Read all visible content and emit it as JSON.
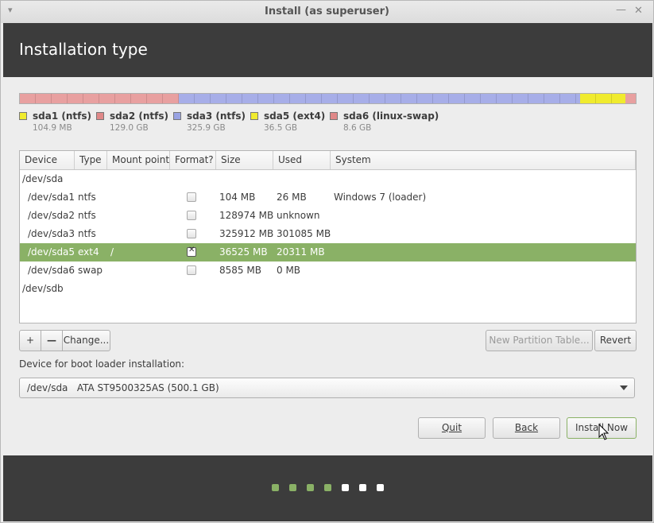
{
  "window": {
    "title": "Install (as superuser)",
    "menu_glyph": "▾",
    "minimize_glyph": "—",
    "close_glyph": "✕"
  },
  "header": {
    "title": "Installation type"
  },
  "partition_bar": {
    "segments": [
      {
        "id": "sda1",
        "color": "#f0eb2e",
        "share": 0.0002
      },
      {
        "id": "sda2",
        "color": "#e8a0a0",
        "share": 0.2579
      },
      {
        "id": "sda3",
        "color": "#a7aee8",
        "share": 0.6516
      },
      {
        "id": "sda5",
        "color": "#f0eb2e",
        "share": 0.073
      },
      {
        "id": "sda6",
        "color": "#e8a0a0",
        "share": 0.0173
      }
    ]
  },
  "legend": [
    {
      "name": "sda1 (ntfs)",
      "size": "104.9 MB",
      "color": "#f0eb2e"
    },
    {
      "name": "sda2 (ntfs)",
      "size": "129.0 GB",
      "color": "#e08888"
    },
    {
      "name": "sda3 (ntfs)",
      "size": "325.9 GB",
      "color": "#99a3e3"
    },
    {
      "name": "sda5 (ext4)",
      "size": "36.5 GB",
      "color": "#f0eb2e"
    },
    {
      "name": "sda6 (linux-swap)",
      "size": "8.6 GB",
      "color": "#e08888"
    }
  ],
  "table": {
    "headers": [
      "Device",
      "Type",
      "Mount point",
      "Format?",
      "Size",
      "Used",
      "System"
    ],
    "rows": [
      {
        "device": "/dev/sda",
        "type": "",
        "mount": "",
        "format": null,
        "size": "",
        "used": "",
        "system": "",
        "disk": true
      },
      {
        "device": "/dev/sda1",
        "type": "ntfs",
        "mount": "",
        "format": false,
        "size": "104 MB",
        "used": "26 MB",
        "system": "Windows 7 (loader)"
      },
      {
        "device": "/dev/sda2",
        "type": "ntfs",
        "mount": "",
        "format": false,
        "size": "128974 MB",
        "used": "unknown",
        "system": ""
      },
      {
        "device": "/dev/sda3",
        "type": "ntfs",
        "mount": "",
        "format": false,
        "size": "325912 MB",
        "used": "301085 MB",
        "system": ""
      },
      {
        "device": "/dev/sda5",
        "type": "ext4",
        "mount": "/",
        "format": true,
        "size": "36525 MB",
        "used": "20311 MB",
        "system": "",
        "selected": true
      },
      {
        "device": "/dev/sda6",
        "type": "swap",
        "mount": "",
        "format": false,
        "size": "8585 MB",
        "used": "0 MB",
        "system": ""
      },
      {
        "device": "/dev/sdb",
        "type": "",
        "mount": "",
        "format": null,
        "size": "",
        "used": "",
        "system": "",
        "disk": true
      }
    ]
  },
  "toolbar": {
    "add_label": "+",
    "remove_label": "—",
    "change_label": "Change...",
    "new_table_label": "New Partition Table...",
    "revert_label": "Revert"
  },
  "bootloader": {
    "label": "Device for boot loader installation:",
    "value": "/dev/sda   ATA ST9500325AS (500.1 GB)"
  },
  "actions": {
    "quit_label": "Quit",
    "back_label": "Back",
    "install_label": "Install Now"
  },
  "progress": {
    "total_steps": 7,
    "completed_steps": 4,
    "done_color": "#8ab166",
    "todo_color": "#ffffff"
  }
}
